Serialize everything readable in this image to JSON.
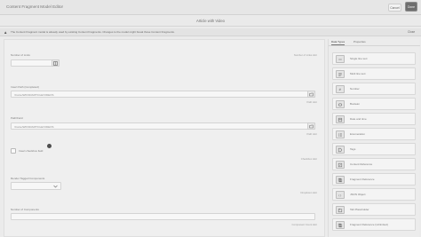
{
  "app": {
    "title": "Content Fragment Model Editor",
    "cancel_label": "Cancel",
    "done_label": "Done"
  },
  "subheader": {
    "title": "Article with Video"
  },
  "warning": {
    "text": "The Content Fragment model is already used by existing Content Fragments. Changes to the model might break those Content Fragments.",
    "close_label": "Close"
  },
  "form": {
    "fields": [
      {
        "label": "Number of Links",
        "hint": "Number of Links Hint",
        "value": ""
      },
      {
        "label": "Insert Path (Completed)",
        "hint": "Path Hint",
        "value": "/Conte/WKND/ARTICLE/VIDEOS"
      },
      {
        "label": "Path/Field",
        "hint": "Path Hint",
        "value": "/Conte/WKND/ARTICLE/VIDEOS"
      },
      {
        "label": "Insert checkbox field",
        "hint": "Checkbox Hint"
      },
      {
        "label": "Render Tagged Components",
        "hint": "Dropdown Hint"
      },
      {
        "label": "Number of Components",
        "hint": "Component Count Hint",
        "value": ""
      }
    ]
  },
  "right_panel": {
    "tabs": [
      "Data Types",
      "Properties"
    ],
    "components": [
      {
        "label": "Single line text",
        "icon": "text-icon"
      },
      {
        "label": "Multi line text",
        "icon": "multiline-icon"
      },
      {
        "label": "Number",
        "icon": "number-icon"
      },
      {
        "label": "Boolean",
        "icon": "boolean-icon"
      },
      {
        "label": "Date and time",
        "icon": "calendar-icon"
      },
      {
        "label": "Enumeration",
        "icon": "enumeration-icon"
      },
      {
        "label": "Tags",
        "icon": "tag-icon"
      },
      {
        "label": "Content Reference",
        "icon": "content-reference-icon"
      },
      {
        "label": "Fragment Reference",
        "icon": "fragment-reference-icon"
      },
      {
        "label": "JSON Object",
        "icon": "json-icon"
      },
      {
        "label": "Tab Placeholder",
        "icon": "tab-placeholder-icon"
      },
      {
        "label": "Fragment Reference (Unlimited)",
        "icon": "fragment-reference-icon"
      }
    ]
  }
}
